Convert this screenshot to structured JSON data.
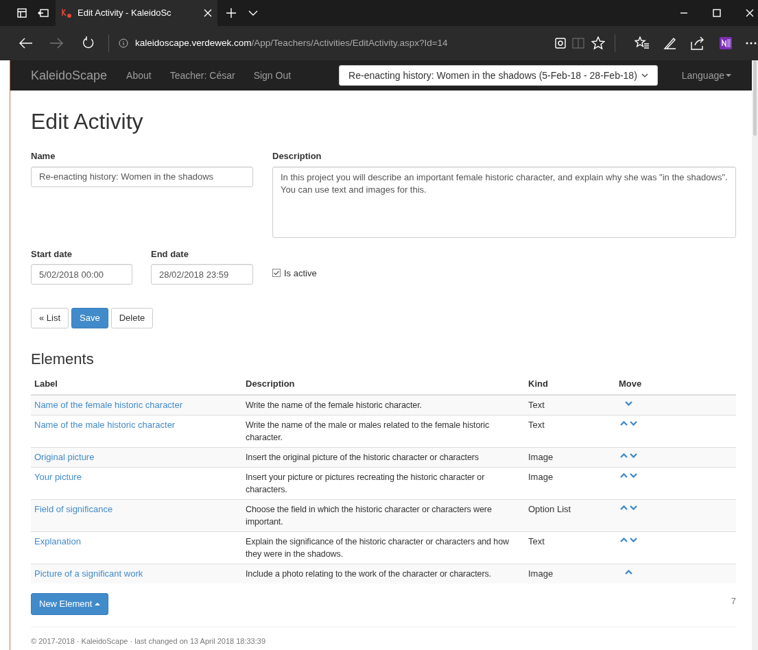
{
  "browser": {
    "tab_title": "Edit Activity - KaleidoSc",
    "url_host": "kaleidoscape.verdewek.com",
    "url_path": "/App/Teachers/Activities/EditActivity.aspx?Id=14"
  },
  "navbar": {
    "brand": "KaleidoScape",
    "links": [
      "About",
      "Teacher: César",
      "Sign Out"
    ],
    "activity_select": "Re-enacting history: Women in the shadows (5-Feb-18 - 28-Feb-18)",
    "language": "Language"
  },
  "page_title": "Edit Activity",
  "form": {
    "name_label": "Name",
    "name_value": "Re-enacting history: Women in the shadows",
    "description_label": "Description",
    "description_value": "In this project you will describe an important female historic character, and explain why she was \"in the shadows\".\nYou can use text and images for this.",
    "start_label": "Start date",
    "start_value": "5/02/2018 00:00",
    "end_label": "End date",
    "end_value": "28/02/2018 23:59",
    "active_label": "Is active",
    "active_checked": true
  },
  "buttons": [
    {
      "label": "« List",
      "primary": false
    },
    {
      "label": "Save",
      "primary": true
    },
    {
      "label": "Delete",
      "primary": false
    }
  ],
  "elements": {
    "title": "Elements",
    "columns": [
      "Label",
      "Description",
      "Kind",
      "Move"
    ],
    "rows": [
      {
        "label": "Name of the female historic character",
        "description": "Write the name of the female historic character.",
        "kind": "Text",
        "up": false,
        "down": true
      },
      {
        "label": "Name of the male historic character",
        "description": "Write the name of the male or males related to the female historic character.",
        "kind": "Text",
        "up": true,
        "down": true
      },
      {
        "label": "Original picture",
        "description": "Insert the original picture of the historic character or characters",
        "kind": "Image",
        "up": true,
        "down": true
      },
      {
        "label": "Your picture",
        "description": "Insert your picture or pictures recreating the historic character or characters.",
        "kind": "Image",
        "up": true,
        "down": true
      },
      {
        "label": "Field of significance",
        "description": "Choose the field in which the historic character or characters were important.",
        "kind": "Option List",
        "up": true,
        "down": true
      },
      {
        "label": "Explanation",
        "description": "Explain the significance of the historic character or characters and how they were in the shadows.",
        "kind": "Text",
        "up": true,
        "down": true
      },
      {
        "label": "Picture of a significant work",
        "description": "Include a photo relating to the work of the character or characters.",
        "kind": "Image",
        "up": true,
        "down": false
      }
    ],
    "new_button": "New Element",
    "count": "7"
  },
  "footer": "© 2017-2018 · KaleidoScape · last changed on 13 April 2018 18:33:39"
}
